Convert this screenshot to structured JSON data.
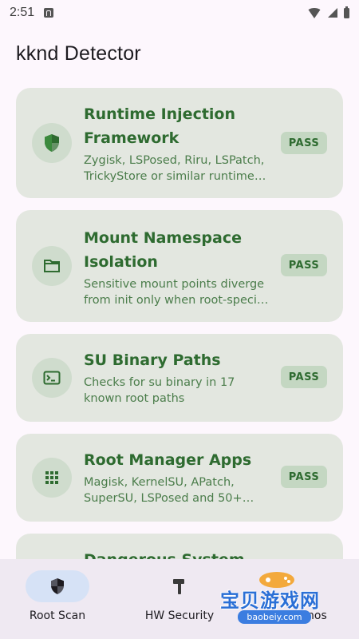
{
  "status_bar": {
    "time": "2:51"
  },
  "app_bar": {
    "title": "kknd Detector"
  },
  "cards": [
    {
      "title": "Runtime Injection Framework",
      "description": "Zygisk, LSPosed, Riru, LSPatch, TrickyStore or similar runtime …",
      "status": "PASS",
      "icon": "shield-icon"
    },
    {
      "title": "Mount Namespace Isolation",
      "description": "Sensitive mount points diverge from init only when root-speci…",
      "status": "PASS",
      "icon": "folder-icon"
    },
    {
      "title": "SU Binary Paths",
      "description": "Checks for su binary in 17 known root paths",
      "status": "PASS",
      "icon": "terminal-icon"
    },
    {
      "title": "Root Manager Apps",
      "description": "Magisk, KernelSU, APatch, SuperSU, LSPosed and 50+ kn…",
      "status": "PASS",
      "icon": "grid-icon"
    },
    {
      "title": "Dangerous System",
      "description": "",
      "status": "",
      "icon": ""
    }
  ],
  "bottom_nav": {
    "items": [
      {
        "label": "Root Scan",
        "icon": "shield-icon",
        "active": true
      },
      {
        "label": "HW Security",
        "icon": "hammer-icon",
        "active": false
      },
      {
        "label": "mos",
        "icon": "",
        "active": false
      }
    ]
  },
  "watermark": {
    "text": "宝贝游戏网",
    "url": "baobeiy.com"
  },
  "colors": {
    "background": "#fdf7fd",
    "card": "#e3e7e0",
    "accent_green": "#2e6b30",
    "badge": "#c4d7c2",
    "nav_active": "#d6e2f6"
  }
}
